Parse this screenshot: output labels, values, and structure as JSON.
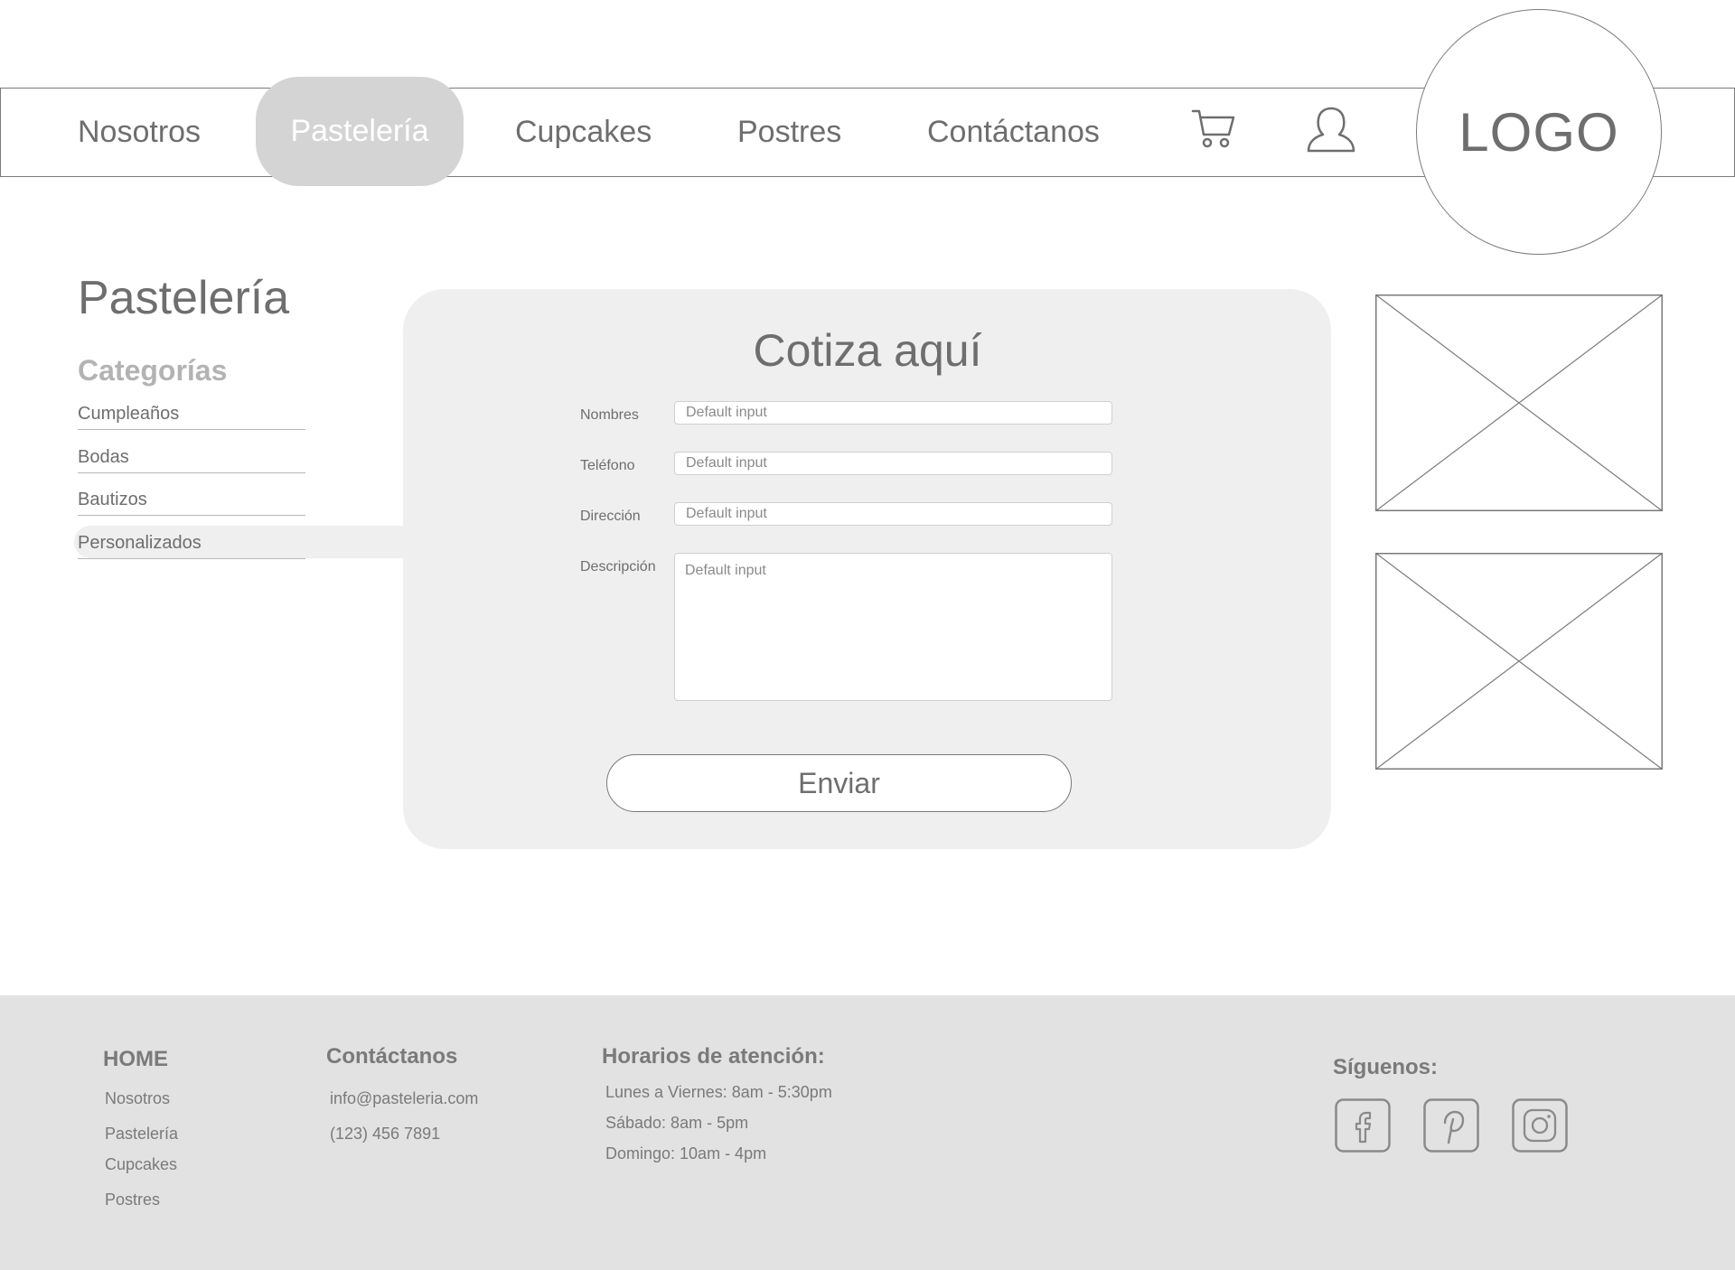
{
  "nav": {
    "items": [
      "Nosotros",
      "Pastelería",
      "Cupcakes",
      "Postres",
      "Contáctanos"
    ],
    "active": "Pastelería",
    "cart_icon": "cart-icon",
    "user_icon": "user-icon",
    "logo": "LOGO"
  },
  "sidebar": {
    "title": "Pastelería",
    "categories_title": "Categorías",
    "categories": [
      "Cumpleaños",
      "Bodas",
      "Bautizos",
      "Personalizados"
    ],
    "active_category": "Personalizados"
  },
  "form": {
    "title": "Cotiza aquí",
    "fields": [
      {
        "label": "Nombres",
        "placeholder": "Default input"
      },
      {
        "label": "Teléfono",
        "placeholder": "Default input"
      },
      {
        "label": "Dirección",
        "placeholder": "Default input"
      },
      {
        "label": "Descripción",
        "placeholder": "Default input"
      }
    ],
    "submit": "Enviar"
  },
  "footer": {
    "home": {
      "title": "HOME",
      "links": [
        "Nosotros",
        "Pastelería",
        "Cupcakes",
        "Postres"
      ]
    },
    "contact": {
      "title": "Contáctanos",
      "email": "info@pasteleria.com",
      "phone": "(123) 456 7891"
    },
    "hours": {
      "title": "Horarios de atención:",
      "lines": [
        "Lunes a Viernes: 8am - 5:30pm",
        "Sábado: 8am - 5pm",
        "Domingo: 10am - 4pm"
      ]
    },
    "social": {
      "title": "Síguenos:",
      "icons": [
        "facebook-icon",
        "pinterest-icon",
        "instagram-icon"
      ]
    }
  },
  "colors": {
    "text": "#6e6e6e",
    "nav_active_bg": "#d4d4d4",
    "card_bg": "#efefef",
    "footer_bg": "#e2e2e2"
  }
}
